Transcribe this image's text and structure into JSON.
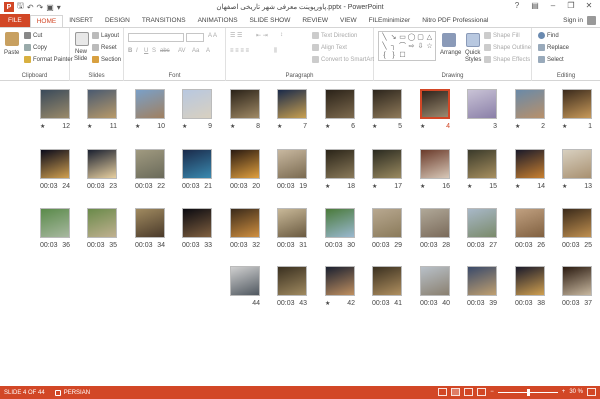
{
  "window": {
    "title": "پاورپوینت معرفی شهر تاریخی اصفهان.pptx - PowerPoint",
    "signin": "Sign in",
    "logo": "P"
  },
  "tabs": [
    "FILE",
    "HOME",
    "INSERT",
    "DESIGN",
    "TRANSITIONS",
    "ANIMATIONS",
    "SLIDE SHOW",
    "REVIEW",
    "VIEW",
    "FILEminimizer",
    "Nitro PDF Professional"
  ],
  "active_tab": "HOME",
  "ribbon": {
    "clipboard": {
      "label": "Clipboard",
      "paste": "Paste",
      "cut": "Cut",
      "copy": "Copy",
      "format_painter": "Format Painter"
    },
    "slides": {
      "label": "Slides",
      "new_slide": "New",
      "new_slide_2": "Slide",
      "layout": "Layout",
      "reset": "Reset",
      "section": "Section"
    },
    "font": {
      "label": "Font"
    },
    "paragraph": {
      "label": "Paragraph",
      "text_direction": "Text Direction",
      "align_text": "Align Text",
      "convert_smartart": "Convert to SmartArt"
    },
    "drawing": {
      "label": "Drawing",
      "arrange": "Arrange",
      "quick_styles": "Quick",
      "quick_styles_2": "Styles",
      "shape_fill": "Shape Fill",
      "shape_outline": "Shape Outline",
      "shape_effects": "Shape Effects"
    },
    "editing": {
      "label": "Editing",
      "find": "Find",
      "replace": "Replace",
      "select": "Select"
    }
  },
  "slides": [
    {
      "num": "1",
      "star": true,
      "time": "",
      "colors": [
        "#3a2a1c",
        "#c89a5a"
      ],
      "selected": false
    },
    {
      "num": "2",
      "star": true,
      "time": "",
      "colors": [
        "#6a8aa8",
        "#b8906a"
      ],
      "selected": false
    },
    {
      "num": "3",
      "star": false,
      "time": "",
      "colors": [
        "#c9c3d6",
        "#8a7fa8"
      ],
      "selected": false
    },
    {
      "num": "4",
      "star": true,
      "time": "",
      "colors": [
        "#2f241c",
        "#9a8a70"
      ],
      "selected": true
    },
    {
      "num": "5",
      "star": true,
      "time": "",
      "colors": [
        "#2c251c",
        "#8f7a5a"
      ],
      "selected": false
    },
    {
      "num": "6",
      "star": true,
      "time": "",
      "colors": [
        "#2a2218",
        "#7d6a4e"
      ],
      "selected": false
    },
    {
      "num": "7",
      "star": true,
      "time": "",
      "colors": [
        "#1a2a4a",
        "#c8a050"
      ],
      "selected": false
    },
    {
      "num": "8",
      "star": true,
      "time": "",
      "colors": [
        "#2a2218",
        "#a08a66"
      ],
      "selected": false
    },
    {
      "num": "9",
      "star": true,
      "time": "",
      "colors": [
        "#b8c8e0",
        "#d8d0c0"
      ],
      "selected": false
    },
    {
      "num": "10",
      "star": true,
      "time": "",
      "colors": [
        "#7aa0c8",
        "#a08060"
      ],
      "selected": false
    },
    {
      "num": "11",
      "star": true,
      "time": "",
      "colors": [
        "#4a5a70",
        "#b89a6a"
      ],
      "selected": false
    },
    {
      "num": "12",
      "star": true,
      "time": "",
      "colors": [
        "#3a4a5a",
        "#9a8a6a"
      ],
      "selected": false
    },
    {
      "num": "13",
      "star": true,
      "time": "",
      "colors": [
        "#d8d0c0",
        "#a89070"
      ],
      "selected": false
    },
    {
      "num": "14",
      "star": true,
      "time": "",
      "colors": [
        "#1a1a2a",
        "#c88030"
      ],
      "selected": false
    },
    {
      "num": "15",
      "star": true,
      "time": "",
      "colors": [
        "#3a3a2a",
        "#a89060"
      ],
      "selected": false
    },
    {
      "num": "16",
      "star": true,
      "time": "",
      "colors": [
        "#6a3a2a",
        "#d8c8b8"
      ],
      "selected": false
    },
    {
      "num": "17",
      "star": true,
      "time": "",
      "colors": [
        "#2a2a20",
        "#9a8a60"
      ],
      "selected": false
    },
    {
      "num": "18",
      "star": true,
      "time": "",
      "colors": [
        "#2a2418",
        "#8a7a5a"
      ],
      "selected": false
    },
    {
      "num": "19",
      "star": false,
      "time": "00:03",
      "colors": [
        "#c8b8a0",
        "#7a6a50"
      ],
      "selected": false
    },
    {
      "num": "20",
      "star": false,
      "time": "00:03",
      "colors": [
        "#2a1a10",
        "#e0a040"
      ],
      "selected": false
    },
    {
      "num": "21",
      "star": false,
      "time": "00:03",
      "colors": [
        "#1a2a4a",
        "#3a8ab0"
      ],
      "selected": false
    },
    {
      "num": "22",
      "star": false,
      "time": "00:03",
      "colors": [
        "#a09a80",
        "#6a6a5a"
      ],
      "selected": false
    },
    {
      "num": "23",
      "star": false,
      "time": "00:03",
      "colors": [
        "#1a2030",
        "#e8d0a0"
      ],
      "selected": false
    },
    {
      "num": "24",
      "star": false,
      "time": "00:03",
      "colors": [
        "#0a0a1a",
        "#d0a050"
      ],
      "selected": false
    },
    {
      "num": "25",
      "star": false,
      "time": "00:03",
      "colors": [
        "#3a2a1a",
        "#c09050"
      ],
      "selected": false
    },
    {
      "num": "26",
      "star": false,
      "time": "00:03",
      "colors": [
        "#c0a080",
        "#806040"
      ],
      "selected": false
    },
    {
      "num": "27",
      "star": false,
      "time": "00:03",
      "colors": [
        "#a8b8c8",
        "#7a8a6a"
      ],
      "selected": false
    },
    {
      "num": "28",
      "star": false,
      "time": "00:03",
      "colors": [
        "#b0a898",
        "#7a6a5a"
      ],
      "selected": false
    },
    {
      "num": "29",
      "star": false,
      "time": "00:03",
      "colors": [
        "#b8a890",
        "#8a7a5a"
      ],
      "selected": false
    },
    {
      "num": "30",
      "star": false,
      "time": "00:03",
      "colors": [
        "#4a7a3a",
        "#9ab8d0"
      ],
      "selected": false
    },
    {
      "num": "31",
      "star": false,
      "time": "00:03",
      "colors": [
        "#c8b898",
        "#6a5a40"
      ],
      "selected": false
    },
    {
      "num": "32",
      "star": false,
      "time": "00:03",
      "colors": [
        "#3a2a1a",
        "#d09040"
      ],
      "selected": false
    },
    {
      "num": "33",
      "star": false,
      "time": "00:03",
      "colors": [
        "#0a0a10",
        "#806040"
      ],
      "selected": false
    },
    {
      "num": "34",
      "star": false,
      "time": "00:03",
      "colors": [
        "#a08a60",
        "#4a3a2a"
      ],
      "selected": false
    },
    {
      "num": "35",
      "star": false,
      "time": "00:03",
      "colors": [
        "#6a8a4a",
        "#c0b090"
      ],
      "selected": false
    },
    {
      "num": "36",
      "star": false,
      "time": "00:03",
      "colors": [
        "#5a8a4a",
        "#a8b8a0"
      ],
      "selected": false
    },
    {
      "num": "37",
      "star": false,
      "time": "00:03",
      "colors": [
        "#2a1a10",
        "#c8b8a0"
      ],
      "selected": false
    },
    {
      "num": "38",
      "star": false,
      "time": "00:03",
      "colors": [
        "#1a1a2a",
        "#d0a050"
      ],
      "selected": false
    },
    {
      "num": "39",
      "star": false,
      "time": "00:03",
      "colors": [
        "#3a4a6a",
        "#c0a070"
      ],
      "selected": false
    },
    {
      "num": "40",
      "star": false,
      "time": "00:03",
      "colors": [
        "#b8c0c8",
        "#8a8070"
      ],
      "selected": false
    },
    {
      "num": "41",
      "star": false,
      "time": "00:03",
      "colors": [
        "#3a3020",
        "#b09060"
      ],
      "selected": false
    },
    {
      "num": "42",
      "star": true,
      "time": "",
      "colors": [
        "#1a2030",
        "#c09060"
      ],
      "selected": false
    },
    {
      "num": "43",
      "star": false,
      "time": "00:03",
      "colors": [
        "#3a3020",
        "#a08a60"
      ],
      "selected": false
    },
    {
      "num": "44",
      "star": false,
      "time": "",
      "colors": [
        "#d0d0d0",
        "#505860"
      ],
      "selected": false
    }
  ],
  "status": {
    "slide_info": "SLIDE 4 OF 44",
    "language": "PERSIAN",
    "zoom": "30 %",
    "zoom_fraction": 0.3
  }
}
